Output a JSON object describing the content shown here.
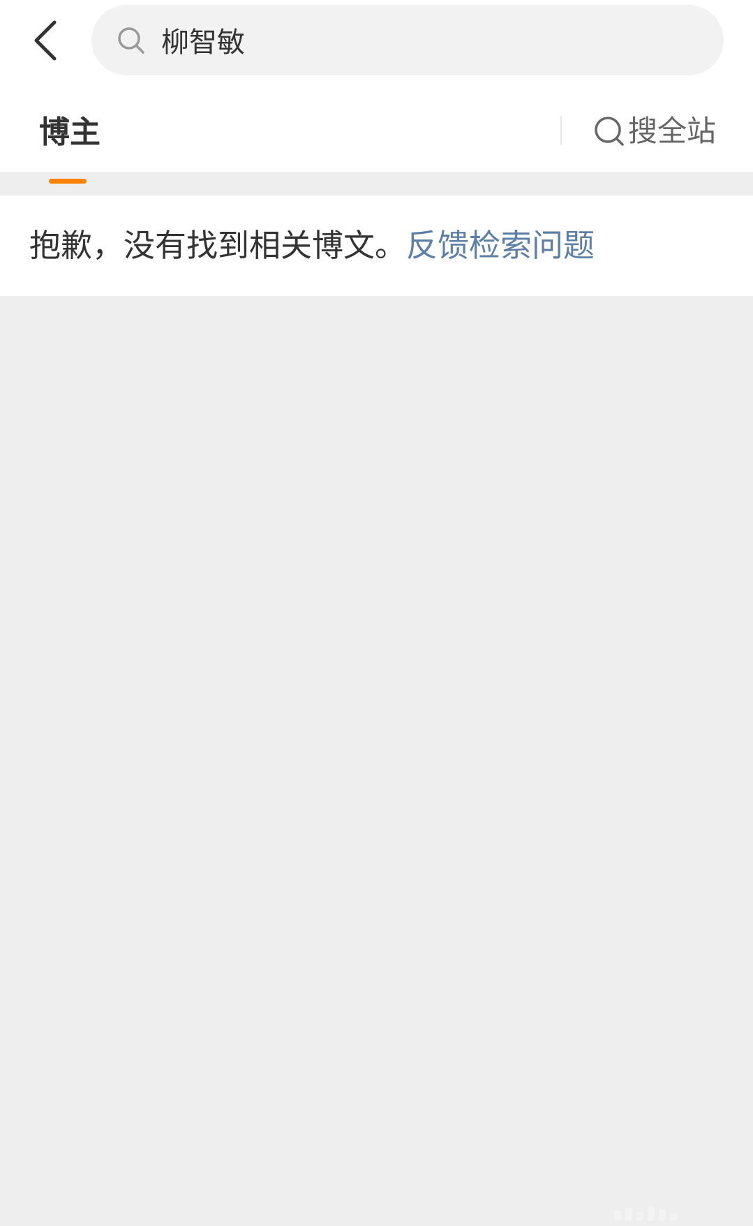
{
  "search": {
    "query": "柳智敏",
    "icon": "search-icon"
  },
  "back": {
    "icon": "back-arrow-icon"
  },
  "tabs": {
    "active_label": "博主",
    "search_all_label": "搜全站",
    "search_all_icon": "search-icon"
  },
  "notice": {
    "message": "抱歉，没有找到相关博文。",
    "link_label": "反馈检索问题"
  },
  "colors": {
    "accent": "#ff8200",
    "link": "#5d7fa6",
    "text": "#333333",
    "muted": "#666666",
    "page_bg": "#eeeeee"
  }
}
